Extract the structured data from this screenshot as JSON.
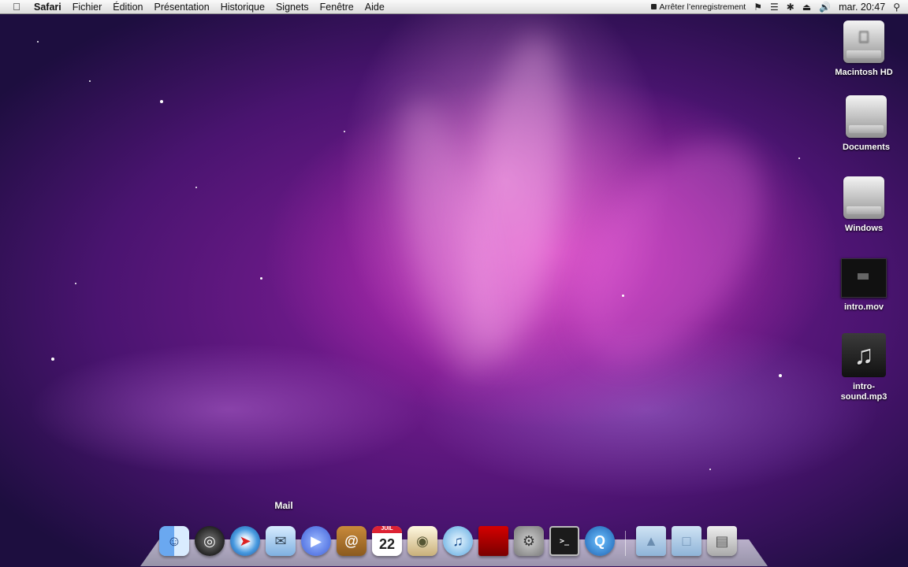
{
  "menubar": {
    "apple_icon": "apple-icon",
    "app_name": "Safari",
    "menus": [
      "Fichier",
      "Édition",
      "Présentation",
      "Historique",
      "Signets",
      "Fenêtre",
      "Aide"
    ],
    "status": {
      "record_label": "Arrêter l’enregistrement",
      "clock": "mar. 20:47",
      "icons": [
        "record-icon",
        "cat-icon",
        "wifi-icon",
        "bluetooth-icon",
        "eject-icon",
        "volume-icon",
        "spotlight-icon"
      ]
    }
  },
  "desktop": {
    "icons": [
      {
        "label": "Macintosh HD",
        "kind": "drive"
      },
      {
        "label": "Documents",
        "kind": "drive"
      },
      {
        "label": "Windows",
        "kind": "drive"
      },
      {
        "label": "intro.mov",
        "kind": "movie"
      },
      {
        "label": "intro-sound.mp3",
        "kind": "audio",
        "label_lines": [
          "intro-",
          "sound.mp3"
        ]
      }
    ]
  },
  "dock": {
    "tooltip": "Mail",
    "ical_date": "22",
    "ical_month": "JUIL",
    "terminal_prompt": ">_",
    "apps": [
      "finder-icon",
      "dashboard-icon",
      "safari-icon",
      "mail-icon",
      "ichat-icon",
      "address-book-icon",
      "ical-icon",
      "iphoto-icon",
      "itunes-icon",
      "photo-booth-icon",
      "system-preferences-icon",
      "terminal-icon",
      "quicktime-icon"
    ],
    "stacks": [
      "applications-folder-icon",
      "documents-folder-icon",
      "trash-icon"
    ]
  }
}
